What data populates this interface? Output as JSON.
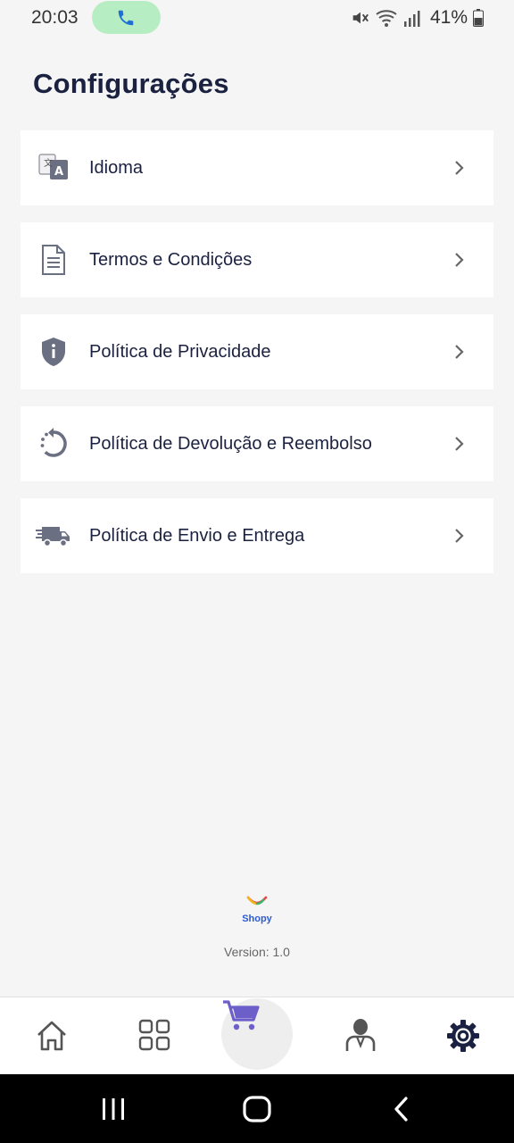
{
  "status_bar": {
    "time": "20:03",
    "battery": "41%"
  },
  "page": {
    "title": "Configurações"
  },
  "settings": [
    {
      "label": "Idioma",
      "icon": "translate-icon"
    },
    {
      "label": "Termos e Condições",
      "icon": "document-icon"
    },
    {
      "label": "Política de Privacidade",
      "icon": "shield-info-icon"
    },
    {
      "label": "Política de Devolução e Reembolso",
      "icon": "return-icon"
    },
    {
      "label": "Política de Envio e Entrega",
      "icon": "truck-icon"
    }
  ],
  "footer": {
    "brand": "Shopy",
    "version": "Version: 1.0"
  },
  "bottom_nav": [
    {
      "name": "home",
      "icon": "home-icon"
    },
    {
      "name": "categories",
      "icon": "grid-icon"
    },
    {
      "name": "cart",
      "icon": "cart-icon",
      "active": true
    },
    {
      "name": "profile",
      "icon": "user-icon"
    },
    {
      "name": "settings",
      "icon": "gear-icon"
    }
  ],
  "colors": {
    "accent": "#6d5fc9",
    "text": "#1b2140",
    "background": "#f5f5f5",
    "brand_blue": "#2d5bd0"
  }
}
